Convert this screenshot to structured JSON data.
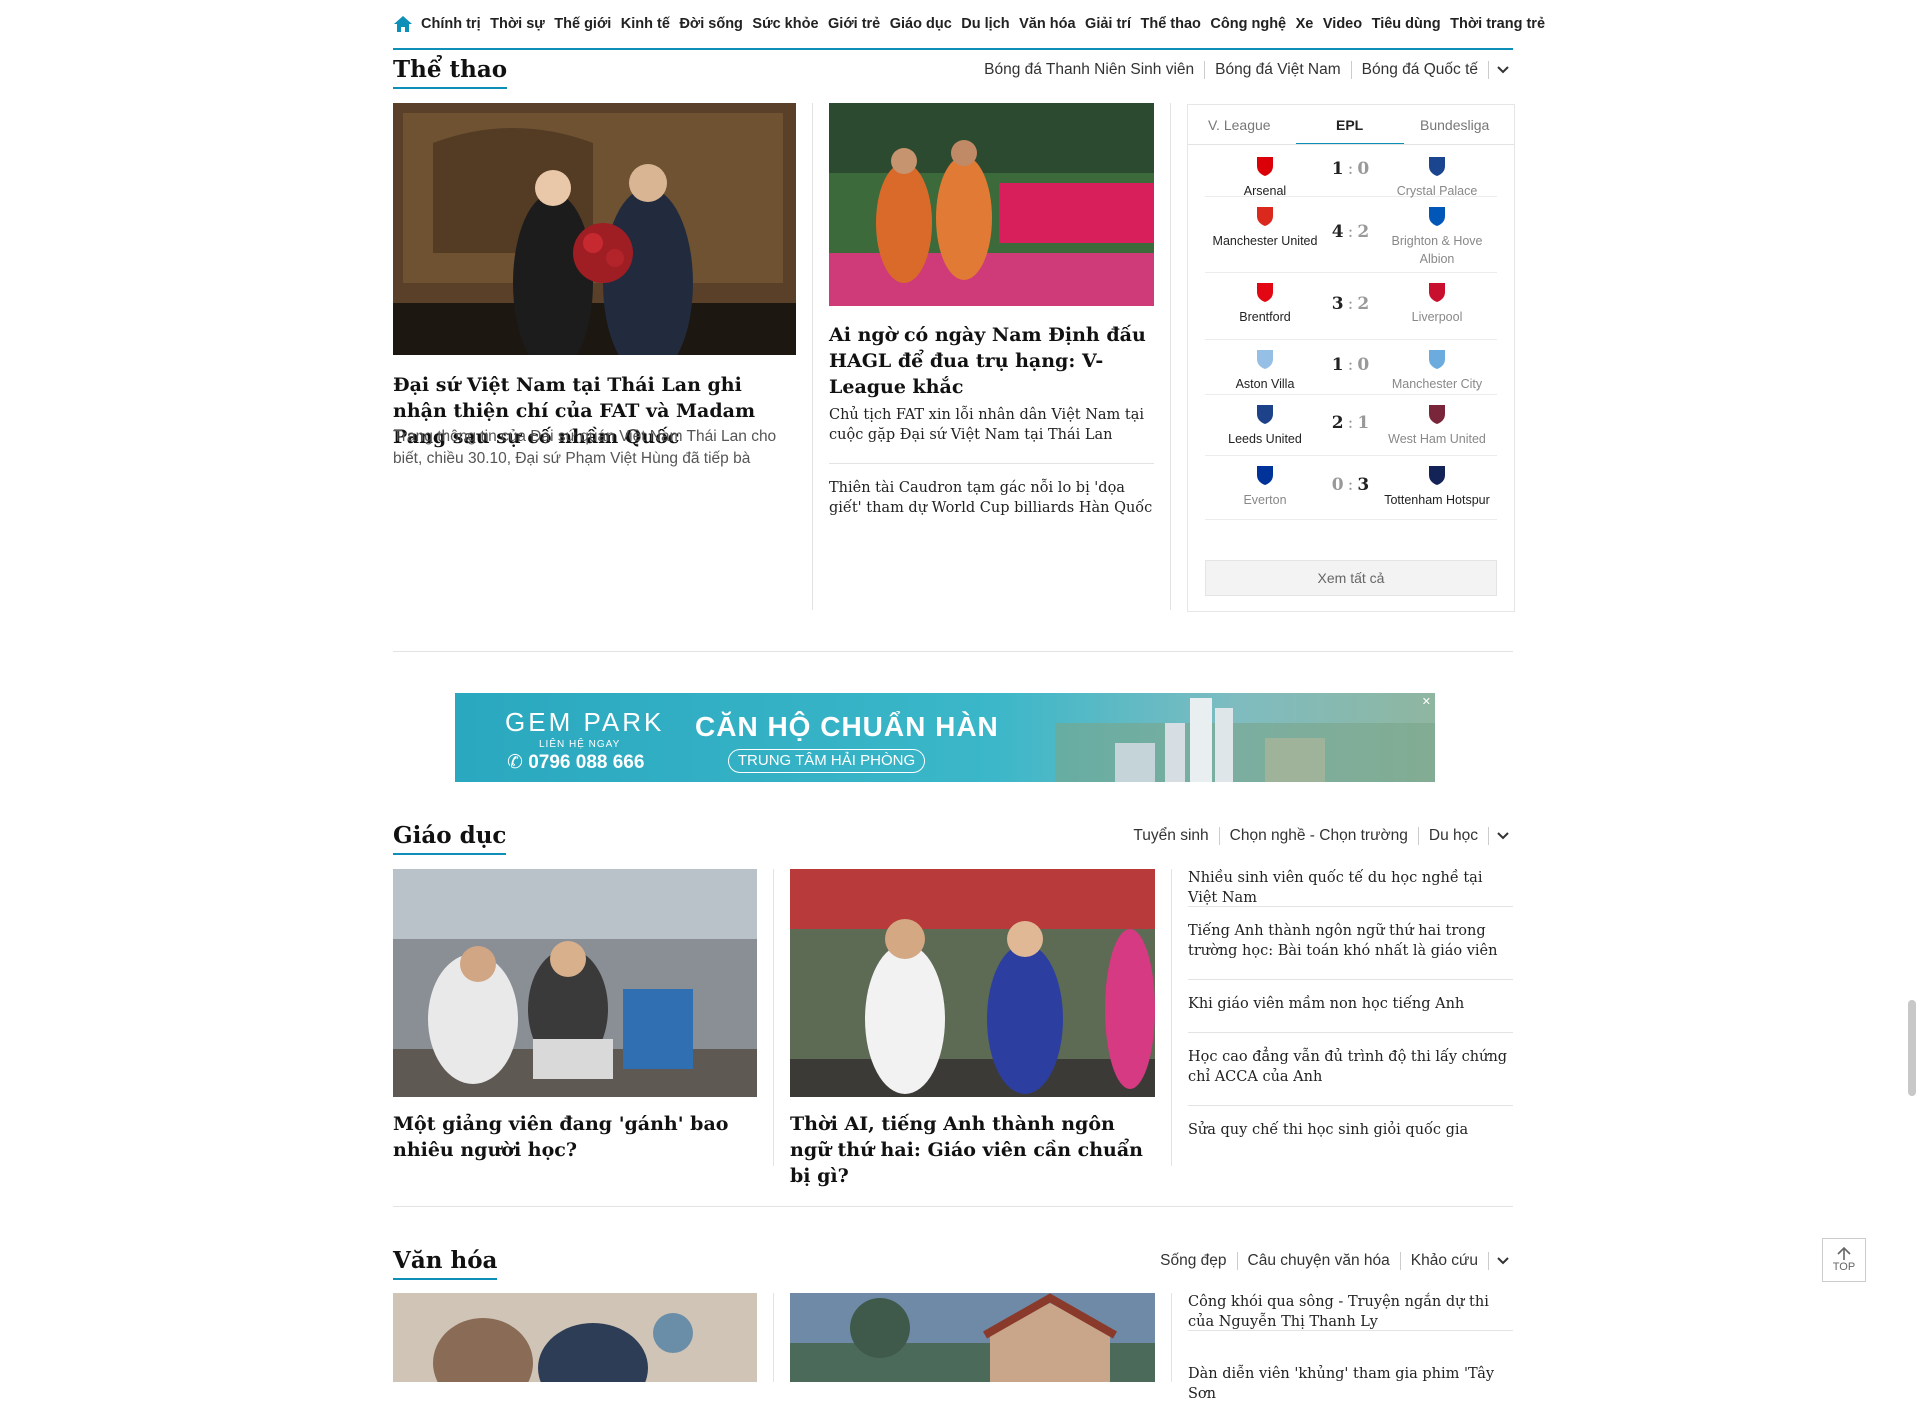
{
  "topnav": {
    "home_icon": "home-icon",
    "items": [
      "Chính trị",
      "Thời sự",
      "Thế giới",
      "Kinh tế",
      "Đời sống",
      "Sức khỏe",
      "Giới trẻ",
      "Giáo dục",
      "Du lịch",
      "Văn hóa",
      "Giải trí",
      "Thể thao",
      "Công nghệ",
      "Xe",
      "Video",
      "Tiêu dùng",
      "Thời trang trẻ"
    ]
  },
  "sport": {
    "title": "Thể thao",
    "subs": [
      "Bóng đá Thanh Niên Sinh viên",
      "Bóng đá Việt Nam",
      "Bóng đá Quốc tế"
    ],
    "main": {
      "headline": "Đại sứ Việt Nam tại Thái Lan ghi nhận thiện chí của FAT và Madam Pang sau sự cố nhầm Quốc",
      "sapo": "Trang thông tin của Đại sứ quán Việt Nam Thái Lan cho biết, chiều 30.10, Đại sứ Phạm Việt Hùng đã tiếp bà"
    },
    "second": {
      "headline": "Ai ngờ có ngày Nam Định đấu HAGL để đua trụ hạng: V-League khắc",
      "links": [
        "Chủ tịch FAT xin lỗi nhân dân Việt Nam tại cuộc gặp Đại sứ Việt Nam tại Thái Lan",
        "Thiên tài Caudron tạm gác nỗi lo bị 'dọa giết' tham dự World Cup billiards Hàn Quốc"
      ]
    },
    "scoreboard": {
      "tabs": [
        "V. League",
        "EPL",
        "Bundesliga"
      ],
      "active_tab": "EPL",
      "matches": [
        {
          "home": "Arsenal",
          "away": "Crystal Palace",
          "hs": "1",
          "as": "0",
          "home_color": "#db0007",
          "away_color": "#1b458f"
        },
        {
          "home": "Manchester United",
          "away": "Brighton & Hove Albion",
          "hs": "4",
          "as": "2",
          "home_color": "#da291c",
          "away_color": "#0057b8"
        },
        {
          "home": "Brentford",
          "away": "Liverpool",
          "hs": "3",
          "as": "2",
          "home_color": "#e30613",
          "away_color": "#c8102e"
        },
        {
          "home": "Aston Villa",
          "away": "Manchester City",
          "hs": "1",
          "as": "0",
          "home_color": "#95bfe5",
          "away_color": "#6cabdd"
        },
        {
          "home": "Leeds United",
          "away": "West Ham United",
          "hs": "2",
          "as": "1",
          "home_color": "#1d428a",
          "away_color": "#7a263a"
        },
        {
          "home": "Everton",
          "away": "Tottenham Hotspur",
          "hs": "0",
          "as": "3",
          "home_color": "#003399",
          "away_color": "#132257"
        }
      ],
      "view_all": "Xem tất cả"
    }
  },
  "ad": {
    "brand": "GEM PARK",
    "contact": "LIÊN HỆ NGAY",
    "phone": "0796 088 666",
    "slogan": "CĂN HỘ CHUẨN HÀN",
    "sub": "TRUNG TÂM HẢI PHÒNG"
  },
  "education": {
    "title": "Giáo dục",
    "subs": [
      "Tuyển sinh",
      "Chọn nghề - Chọn trường",
      "Du học"
    ],
    "items": [
      {
        "headline": "Một giảng viên đang 'gánh' bao nhiêu người học?"
      },
      {
        "headline": "Thời AI, tiếng Anh thành ngôn ngữ thứ hai: Giáo viên cần chuẩn bị gì?"
      }
    ],
    "links": [
      "Nhiều sinh viên quốc tế du học nghề tại Việt Nam",
      "Tiếng Anh thành ngôn ngữ thứ hai trong trường học: Bài toán khó nhất là giáo viên",
      "Khi giáo viên mầm non học tiếng Anh",
      "Học cao đẳng vẫn đủ trình độ thi lấy chứng chỉ ACCA của Anh",
      "Sửa quy chế thi học sinh giỏi quốc gia"
    ]
  },
  "culture": {
    "title": "Văn hóa",
    "subs": [
      "Sống đẹp",
      "Câu chuyện văn hóa",
      "Khảo cứu"
    ],
    "links": [
      "Công khói qua sông - Truyện ngắn dự thi của Nguyễn Thị Thanh Ly",
      "Dàn diễn viên 'khủng' tham gia phim 'Tây Sơn"
    ]
  },
  "top_button": "TOP"
}
